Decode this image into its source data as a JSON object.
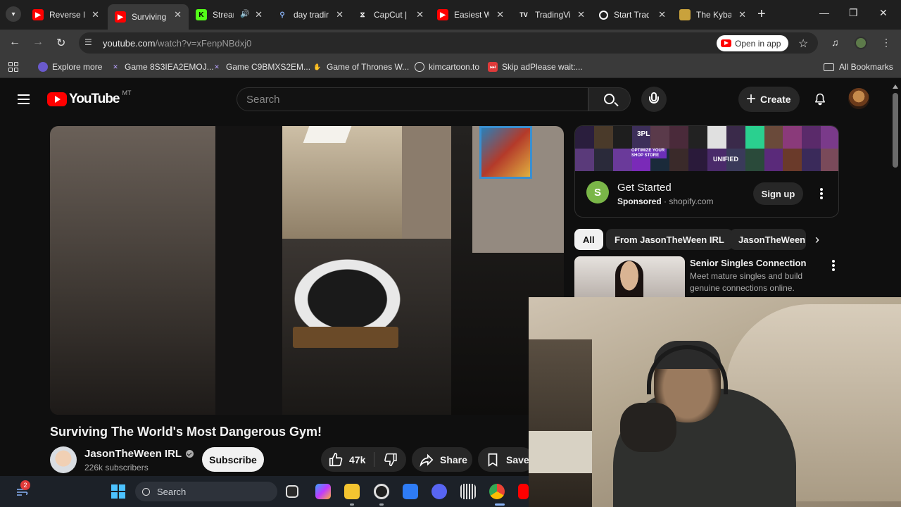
{
  "browser": {
    "tabs": [
      {
        "title": "Reverse K",
        "favicon": "youtube-icon",
        "active": false
      },
      {
        "title": "Surviving",
        "favicon": "youtube-icon",
        "active": true
      },
      {
        "title": "Strean",
        "favicon": "kick-icon",
        "active": false,
        "audio": true
      },
      {
        "title": "day tradir",
        "favicon": "search-icon",
        "active": false
      },
      {
        "title": "CapCut |",
        "favicon": "capcut-icon",
        "active": false
      },
      {
        "title": "Easiest W",
        "favicon": "youtube-icon",
        "active": false
      },
      {
        "title": "TradingVi",
        "favicon": "tradingview-icon",
        "active": false
      },
      {
        "title": "Start Trad",
        "favicon": "globe-icon",
        "active": false
      },
      {
        "title": "The Kybal",
        "favicon": "book-icon",
        "active": false
      }
    ],
    "url_host": "youtube.com",
    "url_path": "/watch?v=xFenpNBdxj0",
    "open_in_app": "Open in app",
    "bookmarks": [
      {
        "label": "Explore more",
        "icon": "explore-icon"
      },
      {
        "label": "Game 8S3IEA2EMOJ...",
        "icon": "game-icon"
      },
      {
        "label": "Game C9BMXS2EM...",
        "icon": "game-icon"
      },
      {
        "label": "Game of Thrones W...",
        "icon": "hand-icon"
      },
      {
        "label": "kimcartoon.to",
        "icon": "globe-icon"
      },
      {
        "label": "Skip adPlease wait:...",
        "icon": "skip-icon"
      }
    ],
    "all_bookmarks": "All Bookmarks"
  },
  "youtube": {
    "logo_text": "YouTube",
    "country_code": "MT",
    "search_placeholder": "Search",
    "create_label": "Create",
    "video": {
      "title": "Surviving The World's Most Dangerous Gym!",
      "channel": "JasonTheWeen IRL",
      "subscribers": "226k subscribers",
      "subscribe_label": "Subscribe",
      "likes": "47k",
      "share_label": "Share",
      "save_label": "Save"
    },
    "ad": {
      "title": "Get Started",
      "sponsored": "Sponsored",
      "domain": "shopify.com",
      "cta": "Sign up",
      "banner_texts": [
        "3PL",
        "OPTIMIZE YOUR SHOP STORE",
        "UNIFIED"
      ]
    },
    "chips": [
      "All",
      "From JasonTheWeen IRL",
      "JasonTheWeen"
    ],
    "reco": {
      "title": "Senior Singles Connection",
      "description": "Meet mature singles and build genuine connections online."
    }
  },
  "taskbar": {
    "notification_count": "2",
    "search_placeholder": "Search"
  }
}
